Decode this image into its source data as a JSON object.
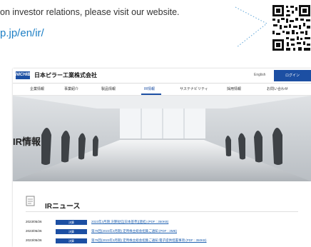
{
  "intro": {
    "line": "on investor relations, please visit our website.",
    "url": "p.jp/en/ir/"
  },
  "site": {
    "logo_badge": "NICHIBI",
    "company_name": "日本ピラー工業株式会社",
    "lang_link": "English",
    "header_button": "ログイン",
    "nav": [
      "企業情報",
      "事業紹介",
      "製品情報",
      "IR情報",
      "サステナビリティ",
      "採用情報",
      "お問い合わせ"
    ],
    "hero_title": "IR情報",
    "news_heading": "IRニュース",
    "news": [
      {
        "date": "2023/05/26",
        "tag": "決算",
        "title": "2023年3月期 決算短信[日本基準](連結)  (PDF : 350KB)"
      },
      {
        "date": "2023/05/26",
        "tag": "決算",
        "title": "第79回(2023年3月期) 定時株主総会招集ご通知 (PDF : 3MB)"
      },
      {
        "date": "2023/05/26",
        "tag": "決算",
        "title": "第79回(2023年3月期) 定時株主総会招集ご通知 電子提供措置事項 (PDF : 350KB)"
      }
    ]
  },
  "colors": {
    "brand_blue": "#1c4fa3",
    "url_blue": "#1d7fc5"
  }
}
